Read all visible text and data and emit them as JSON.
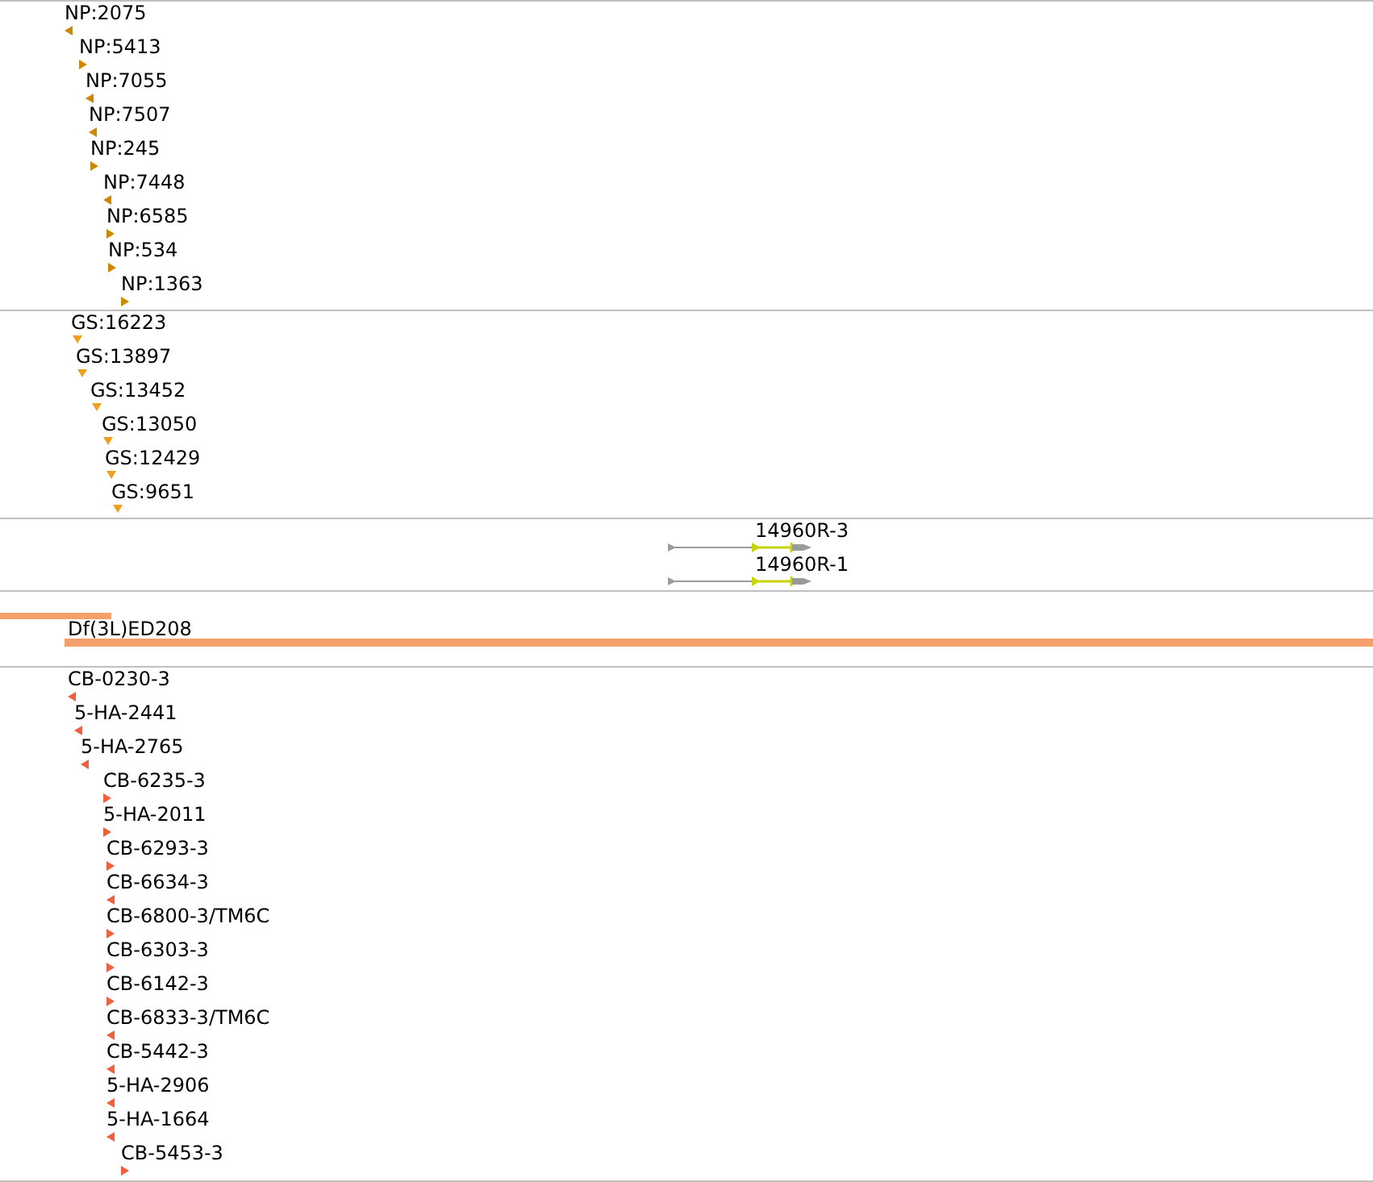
{
  "tracks": [
    {
      "kind": "features",
      "color": "#cc8800",
      "features": [
        {
          "label": "NP:2075",
          "kind": "reverse"
        },
        {
          "label": "NP:5413",
          "kind": "forward"
        },
        {
          "label": "NP:7055",
          "kind": "reverse"
        },
        {
          "label": "NP:7507",
          "kind": "reverse"
        },
        {
          "label": "NP:245",
          "kind": "forward"
        },
        {
          "label": "NP:7448",
          "kind": "reverse"
        },
        {
          "label": "NP:6585",
          "kind": "forward"
        },
        {
          "label": "NP:534",
          "kind": "forward"
        },
        {
          "label": "NP:1363",
          "kind": "forward"
        }
      ]
    },
    {
      "kind": "features",
      "color": "#f0a020",
      "features": [
        {
          "label": "GS:16223",
          "kind": "unstranded"
        },
        {
          "label": "GS:13897",
          "kind": "unstranded"
        },
        {
          "label": "GS:13452",
          "kind": "unstranded"
        },
        {
          "label": "GS:13050",
          "kind": "unstranded"
        },
        {
          "label": "GS:12429",
          "kind": "unstranded"
        },
        {
          "label": "GS:9651",
          "kind": "unstranded"
        }
      ]
    },
    {
      "kind": "transcripts",
      "transcripts": [
        {
          "label": "14960R-3"
        },
        {
          "label": "14960R-1"
        }
      ]
    },
    {
      "kind": "deficiencies",
      "color": "#f5a06c",
      "bars": [
        {
          "kind": "clipped"
        },
        {
          "kind": "labeled",
          "label": "Df(3L)ED208"
        }
      ]
    },
    {
      "kind": "features",
      "color": "#f0603c",
      "features": [
        {
          "label": "CB-0230-3",
          "kind": "reverse"
        },
        {
          "label": "5-HA-2441",
          "kind": "reverse"
        },
        {
          "label": "5-HA-2765",
          "kind": "reverse"
        },
        {
          "label": "CB-6235-3",
          "kind": "forward"
        },
        {
          "label": "5-HA-2011",
          "kind": "forward"
        },
        {
          "label": "CB-6293-3",
          "kind": "forward"
        },
        {
          "label": "CB-6634-3",
          "kind": "reverse"
        },
        {
          "label": "CB-6800-3/TM6C",
          "kind": "forward"
        },
        {
          "label": "CB-6303-3",
          "kind": "forward"
        },
        {
          "label": "CB-6142-3",
          "kind": "forward"
        },
        {
          "label": "CB-6833-3/TM6C",
          "kind": "reverse"
        },
        {
          "label": "CB-5442-3",
          "kind": "reverse"
        },
        {
          "label": "5-HA-2906",
          "kind": "reverse"
        },
        {
          "label": "5-HA-1664",
          "kind": "reverse"
        },
        {
          "label": "CB-5453-3",
          "kind": "forward"
        }
      ]
    }
  ]
}
